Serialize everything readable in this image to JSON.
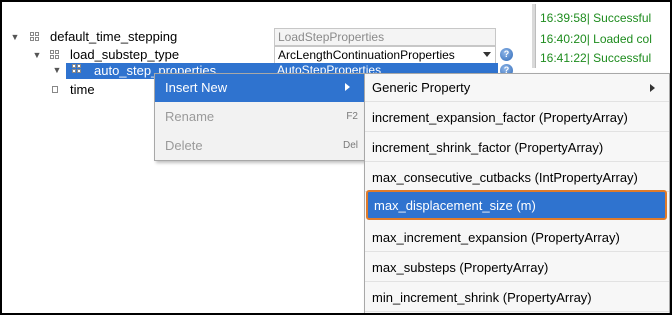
{
  "tree": {
    "rows": [
      {
        "label": "default_time_stepping",
        "value": "LoadStepProperties"
      },
      {
        "label": "load_substep_type",
        "value": "ArcLengthContinuationProperties"
      },
      {
        "label": "auto_step_properties",
        "value": "AutoStepProperties"
      },
      {
        "label": "time"
      }
    ],
    "help_glyph": "?"
  },
  "log": {
    "lines": [
      "16:39:58| Successful",
      "16:40:20| Loaded col",
      "16:41:22| Successful"
    ]
  },
  "context_menu": {
    "items": [
      {
        "label": "Insert New",
        "shortcut": ""
      },
      {
        "label": "Rename",
        "shortcut": "F2"
      },
      {
        "label": "Delete",
        "shortcut": "Del"
      }
    ]
  },
  "submenu": {
    "items": [
      {
        "label": "Generic Property"
      },
      {
        "label": "increment_expansion_factor (PropertyArray)"
      },
      {
        "label": "increment_shrink_factor (PropertyArray)"
      },
      {
        "label": "max_consecutive_cutbacks (IntPropertyArray)"
      },
      {
        "label": "max_displacement_size (m)"
      },
      {
        "label": "max_increment_expansion (PropertyArray)"
      },
      {
        "label": "max_substeps (PropertyArray)"
      },
      {
        "label": "min_increment_shrink (PropertyArray)"
      }
    ]
  },
  "colors": {
    "selection": "#2f73cf",
    "log_text": "#1e8c1e",
    "highlight_border": "#e07b2a"
  }
}
